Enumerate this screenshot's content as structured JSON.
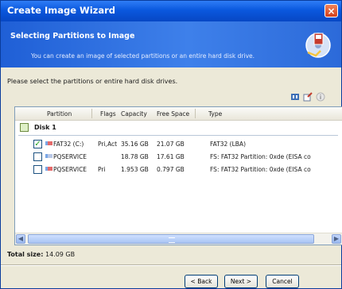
{
  "window": {
    "title": "Create Image Wizard",
    "close_glyph": "×"
  },
  "header": {
    "title": "Selecting Partitions to Image",
    "subtitle": "You can create an image of selected partitions or an entire hard disk drive."
  },
  "instruction": "Please select the partitions or entire hard disk drives.",
  "toolbar": {
    "icons": [
      "properties-icon",
      "edit-icon",
      "info-icon"
    ]
  },
  "columns": {
    "partition": "Partition",
    "flags": "Flags",
    "capacity": "Capacity",
    "free_space": "Free Space",
    "type": "Type"
  },
  "disk": {
    "label": "Disk 1"
  },
  "partitions": [
    {
      "checked": true,
      "checkmark": "✓",
      "name": "FAT32 (C:)",
      "flags": "Pri,Act",
      "capacity": "35.16 GB",
      "free_space": "21.07 GB",
      "type": "FAT32 (LBA)"
    },
    {
      "checked": false,
      "checkmark": "",
      "name": "PQSERVICE",
      "flags": "",
      "capacity": "18.78 GB",
      "free_space": "17.61 GB",
      "type": "FS: FAT32 Partition: 0xde (EISA co"
    },
    {
      "checked": false,
      "checkmark": "",
      "name": "PQSERVICE",
      "flags": "Pri",
      "capacity": "1.953 GB",
      "free_space": "0.797 GB",
      "type": "FS: FAT32 Partition: 0xde (EISA co"
    }
  ],
  "total": {
    "label": "Total size:",
    "value": "14.09 GB"
  },
  "buttons": {
    "back": "< Back",
    "next": "Next >",
    "cancel": "Cancel"
  },
  "colors": {
    "title_bar": "#0a58de",
    "header": "#3e80ea",
    "dialog_bg": "#ece9d8"
  }
}
